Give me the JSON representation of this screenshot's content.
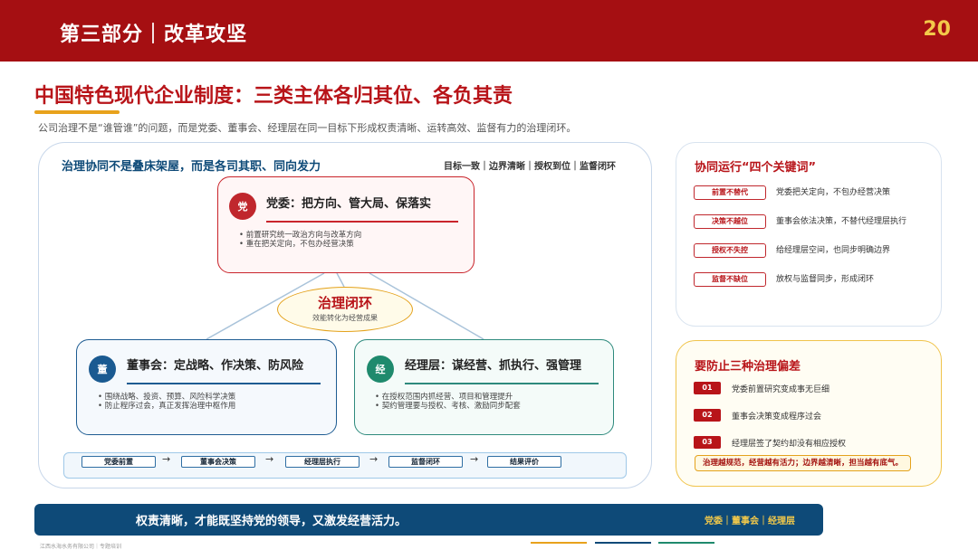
{
  "header": {
    "section_title": "第三部分｜改革攻坚",
    "page_number": "20"
  },
  "title": "中国特色现代企业制度：三类主体各归其位、各负其责",
  "subtitle": "公司治理不是“谁管谁”的问题，而是党委、董事会、经理层在同一目标下形成权责清晰、运转高效、监督有力的治理闭环。",
  "left_panel": {
    "heading": "治理协同不是叠床架屋，而是各司其职、同向发力",
    "tags": "目标一致｜边界清晰｜授权到位｜监督闭环",
    "party": {
      "badge": "党",
      "title": "党委：把方向、管大局、保落实",
      "bullets": [
        "• 前置研究统一政治方向与改革方向",
        "• 重在把关定向，不包办经营决策"
      ]
    },
    "center": {
      "title": "治理闭环",
      "subtitle": "效能转化为经营成果"
    },
    "board": {
      "badge": "董",
      "title": "董事会：定战略、作决策、防风险",
      "bullets": [
        "• 围绕战略、投资、预算、风险科学决策",
        "• 防止程序过会，真正发挥治理中枢作用"
      ]
    },
    "management": {
      "badge": "经",
      "title": "经理层：谋经营、抓执行、强管理",
      "bullets": [
        "• 在授权范围内抓经营、项目和管理提升",
        "• 契约管理要与授权、考核、激励同步配套"
      ]
    },
    "flow": {
      "steps": [
        "党委前置",
        "董事会决策",
        "经理层执行",
        "监督闭环",
        "结果评价"
      ],
      "arrow": "→"
    }
  },
  "keywords": {
    "title": "协同运行“四个关键词”",
    "items": [
      {
        "tag": "前置不替代",
        "desc": "党委把关定向，不包办经营决策"
      },
      {
        "tag": "决策不越位",
        "desc": "董事会依法决策，不替代经理层执行"
      },
      {
        "tag": "授权不失控",
        "desc": "给经理层空间，也同步明确边界"
      },
      {
        "tag": "监督不缺位",
        "desc": "放权与监督同步，形成闭环"
      }
    ]
  },
  "deviations": {
    "title": "要防止三种治理偏差",
    "items": [
      {
        "num": "01",
        "desc": "党委前置研究变成事无巨细"
      },
      {
        "num": "02",
        "desc": "董事会决策变成程序过会"
      },
      {
        "num": "03",
        "desc": "经理层签了契约却没有相应授权"
      }
    ],
    "warning": "治理越规范，经营越有活力；边界越清晰，担当越有底气。"
  },
  "banner": {
    "text": "权责清晰，才能既坚持党的领导，又激发经营活力。",
    "tags": "党委｜董事会｜经理层"
  },
  "footer": {
    "note": "江西水海水务有限公司｜专题培训"
  },
  "colors": {
    "brand_red": "#a50f12",
    "accent_gold": "#e8a21c",
    "navy": "#0e4a78",
    "teal": "#1f8a6d"
  }
}
